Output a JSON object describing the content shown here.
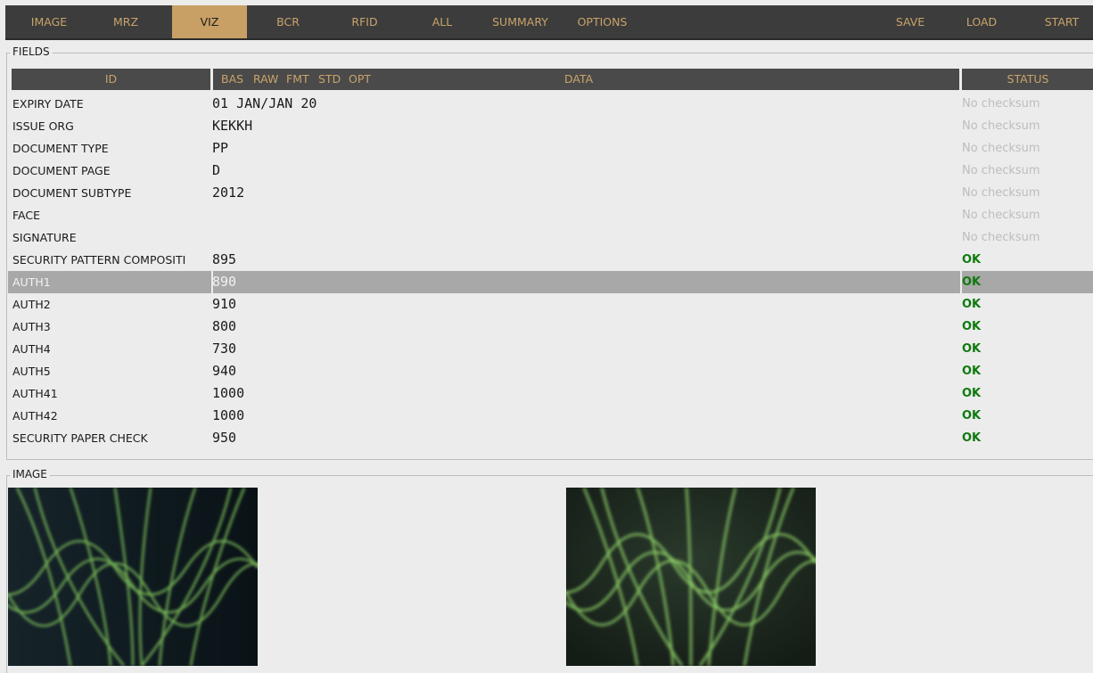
{
  "tabs": [
    {
      "label": "IMAGE",
      "active": false
    },
    {
      "label": "MRZ",
      "active": false
    },
    {
      "label": "VIZ",
      "active": true
    },
    {
      "label": "BCR",
      "active": false
    },
    {
      "label": "RFID",
      "active": false
    },
    {
      "label": "ALL",
      "active": false
    },
    {
      "label": "SUMMARY",
      "active": false
    },
    {
      "label": "OPTIONS",
      "active": false
    }
  ],
  "actions": [
    {
      "label": "SAVE"
    },
    {
      "label": "LOAD"
    },
    {
      "label": "START"
    }
  ],
  "fields": {
    "title": "FIELDS",
    "headers": {
      "id": "ID",
      "bas": "BAS",
      "raw": "RAW",
      "fmt": "FMT",
      "std": "STD",
      "opt": "OPT",
      "data": "DATA",
      "status": "STATUS"
    },
    "rows": [
      {
        "id": "EXPIRY DATE",
        "data": "01 JAN/JAN 20",
        "status": "No checksum",
        "ok": false
      },
      {
        "id": "ISSUE ORG",
        "data": "KEKKH",
        "status": "No checksum",
        "ok": false
      },
      {
        "id": "DOCUMENT TYPE",
        "data": "PP",
        "status": "No checksum",
        "ok": false
      },
      {
        "id": "DOCUMENT PAGE",
        "data": "D",
        "status": "No checksum",
        "ok": false
      },
      {
        "id": "DOCUMENT SUBTYPE",
        "data": "2012",
        "status": "No checksum",
        "ok": false
      },
      {
        "id": "FACE",
        "data": "",
        "status": "No checksum",
        "ok": false
      },
      {
        "id": "SIGNATURE",
        "data": "",
        "status": "No checksum",
        "ok": false
      },
      {
        "id": "SECURITY PATTERN COMPOSITI",
        "data": "895",
        "status": "OK",
        "ok": true
      },
      {
        "id": "AUTH1",
        "data": "890",
        "status": "OK",
        "ok": true,
        "selected": true
      },
      {
        "id": "AUTH2",
        "data": "910",
        "status": "OK",
        "ok": true
      },
      {
        "id": "AUTH3",
        "data": "800",
        "status": "OK",
        "ok": true
      },
      {
        "id": "AUTH4",
        "data": "730",
        "status": "OK",
        "ok": true
      },
      {
        "id": "AUTH5",
        "data": "940",
        "status": "OK",
        "ok": true
      },
      {
        "id": "AUTH41",
        "data": "1000",
        "status": "OK",
        "ok": true
      },
      {
        "id": "AUTH42",
        "data": "1000",
        "status": "OK",
        "ok": true
      },
      {
        "id": "SECURITY PAPER CHECK",
        "data": "950",
        "status": "OK",
        "ok": true
      }
    ]
  },
  "image_section": {
    "title": "IMAGE",
    "images": [
      {
        "name": "security-pattern-image-1",
        "background": "#0f1a1e",
        "line_color": "#7ec25a"
      },
      {
        "name": "security-pattern-image-2",
        "background": "#1d2a22",
        "line_color": "#8fcf6a"
      }
    ]
  },
  "colors": {
    "bar_bg": "#3c3c3c",
    "accent": "#c8a066",
    "ok_green": "#0e7a0e",
    "no_checksum_gray": "#bdbdbd",
    "selected_row": "#a8a8a8"
  }
}
